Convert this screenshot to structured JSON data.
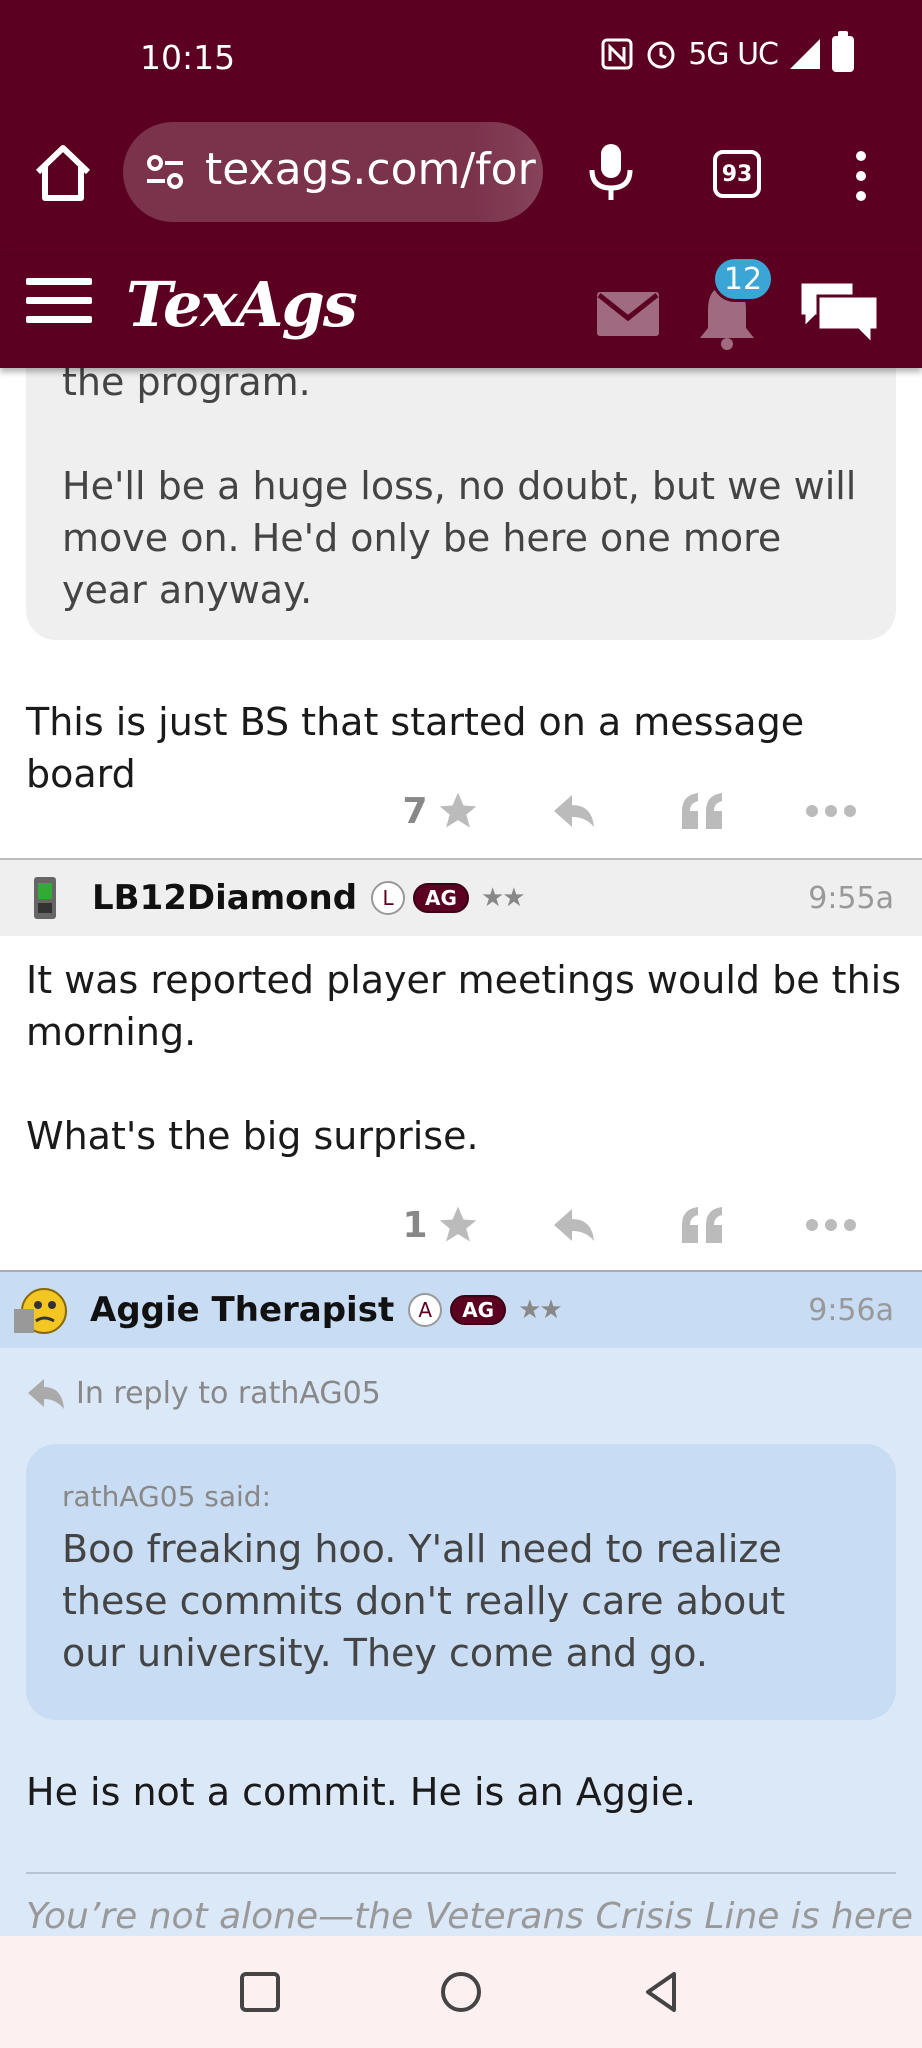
{
  "status_bar": {
    "time": "10:15",
    "network": "5G UC"
  },
  "browser": {
    "url": "texags.com/for",
    "tab_count": "93"
  },
  "site": {
    "logo": "TexAgs",
    "notification_count": "12"
  },
  "posts": {
    "prev_post": {
      "quote_text": "the program.\n\nHe'll be a huge loss, no doubt, but we will move on. He'd only be here one more year anyway.",
      "body": "This is just BS that started on a message board",
      "likes": "7"
    },
    "post_lb12": {
      "username": "LB12Diamond",
      "badge_letter": "L",
      "badge_ag": "AG",
      "stars": "★★",
      "time": "9:55a",
      "body": "It was reported player meetings would be this morning.\n\nWhat's the big surprise.",
      "likes": "1"
    },
    "post_therapist": {
      "username": "Aggie Therapist",
      "badge_letter": "A",
      "badge_ag": "AG",
      "stars": "★★",
      "time": "9:56a",
      "reply_to": "In reply to rathAG05",
      "quote_attrib": "rathAG05 said:",
      "quote_text": "Boo freaking hoo. Y'all need to realize these commits don't really care about our university. They come and go.",
      "body": "He is not a commit. He is an Aggie.",
      "signature": "You’re not alone—the Veterans Crisis Line is here"
    }
  },
  "colors": {
    "maroon": "#5b0020",
    "highlight_post": "#dbe8f8"
  }
}
